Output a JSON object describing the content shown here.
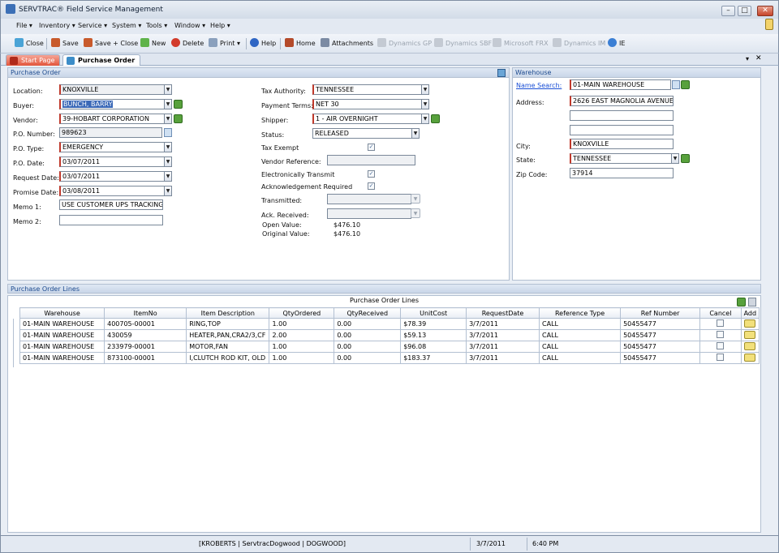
{
  "window": {
    "title": "SERVTRAC® Field Service Management"
  },
  "menu": [
    "File",
    "Inventory",
    "Service",
    "System",
    "Tools",
    "Window",
    "Help"
  ],
  "toolbar": {
    "close": "Close",
    "save": "Save",
    "save_close": "Save + Close",
    "new": "New",
    "delete": "Delete",
    "print": "Print",
    "help": "Help",
    "home": "Home",
    "attachments": "Attachments",
    "dynamics_gp": "Dynamics GP",
    "dynamics_sbf": "Dynamics SBF",
    "microsoft_frx": "Microsoft FRX",
    "dynamics_im": "Dynamics IM",
    "ie": "IE"
  },
  "tabs": {
    "start": "Start Page",
    "po": "Purchase Order"
  },
  "po": {
    "header": "Purchase Order",
    "labels": {
      "location": "Location:",
      "buyer": "Buyer:",
      "vendor": "Vendor:",
      "po_number": "P.O. Number:",
      "po_type": "P.O. Type:",
      "po_date": "P.O. Date:",
      "request_date": "Request Date:",
      "promise_date": "Promise Date:",
      "memo1": "Memo 1:",
      "memo2": "Memo 2:"
    },
    "values": {
      "location": "KNOXVILLE",
      "buyer": "BUNCH, BARRY",
      "vendor": "39-HOBART CORPORATION",
      "po_number": "989623",
      "po_type": "EMERGENCY",
      "po_date": "03/07/2011",
      "request_date": "03/07/2011",
      "promise_date": "03/08/2011",
      "memo1": "USE CUSTOMER UPS TRACKING NO",
      "memo2": ""
    },
    "mid_labels": {
      "tax_authority": "Tax Authority:",
      "payment_terms": "Payment Terms:",
      "shipper": "Shipper:",
      "status": "Status:",
      "tax_exempt": "Tax Exempt",
      "vendor_reference": "Vendor Reference:",
      "electronically_transmit": "Electronically Transmit",
      "ack_required": "Acknowledgement Required",
      "transmitted": "Transmitted:",
      "ack_received": "Ack. Received:",
      "open_value": "Open Value:",
      "original_value": "Original Value:"
    },
    "mid_values": {
      "tax_authority": "TENNESSEE",
      "payment_terms": "NET 30",
      "shipper": "1 - AIR OVERNIGHT",
      "status": "RELEASED",
      "vendor_reference": "",
      "transmitted": "",
      "ack_received": "",
      "open_value": "$476.10",
      "original_value": "$476.10"
    }
  },
  "warehouse": {
    "header": "Warehouse",
    "labels": {
      "name_search": "Name Search:",
      "address": "Address:",
      "city": "City:",
      "state": "State:",
      "zip": "Zip Code:"
    },
    "values": {
      "name": "01-MAIN WAREHOUSE",
      "address1": "2626 EAST MAGNOLIA AVENUE",
      "address2": "",
      "address3": "",
      "city": "KNOXVILLE",
      "state": "TENNESSEE",
      "zip": "37914"
    }
  },
  "lines": {
    "section_header": "Purchase Order Lines",
    "grid_title": "Purchase Order Lines",
    "columns": [
      "Warehouse",
      "ItemNo",
      "Item Description",
      "QtyOrdered",
      "QtyReceived",
      "UnitCost",
      "RequestDate",
      "Reference Type",
      "Ref Number",
      "Cancel",
      "Add"
    ],
    "rows": [
      [
        "01-MAIN WAREHOUSE",
        "400705-00001",
        "RING,TOP",
        "1.00",
        "0.00",
        "$78.39",
        "3/7/2011",
        "CALL",
        "50455477"
      ],
      [
        "01-MAIN WAREHOUSE",
        "430059",
        "HEATER,PAN,CRA2/3,CF",
        "2.00",
        "0.00",
        "$59.13",
        "3/7/2011",
        "CALL",
        "50455477"
      ],
      [
        "01-MAIN WAREHOUSE",
        "233979-00001",
        "MOTOR,FAN",
        "1.00",
        "0.00",
        "$96.08",
        "3/7/2011",
        "CALL",
        "50455477"
      ],
      [
        "01-MAIN WAREHOUSE",
        "873100-00001",
        "I,CLUTCH ROD KIT, OLD",
        "1.00",
        "0.00",
        "$183.37",
        "3/7/2011",
        "CALL",
        "50455477"
      ]
    ]
  },
  "status": {
    "user": "[KROBERTS | ServtracDogwood | DOGWOOD]",
    "date": "3/7/2011",
    "time": "6:40 PM"
  }
}
